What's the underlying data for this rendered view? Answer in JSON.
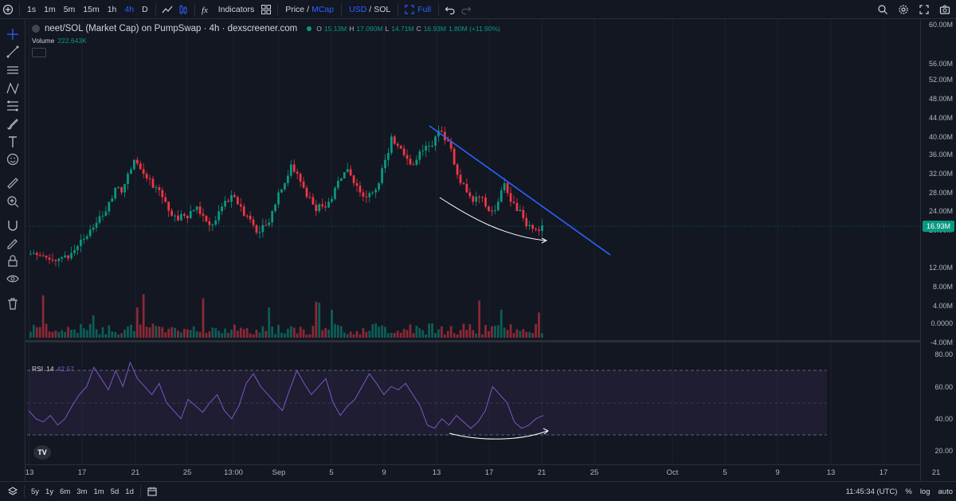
{
  "toolbar": {
    "intervals": [
      "1s",
      "1m",
      "5m",
      "15m",
      "1h",
      "4h",
      "D"
    ],
    "active_interval": "4h",
    "indicators_label": "Indicators",
    "price_label": "Price",
    "price_sep": "/",
    "mcap_label": "MCap",
    "usd_label": "USD",
    "sol_label": "SOL",
    "full_label": "Full"
  },
  "legend": {
    "symbol": "neet/SOL (Market Cap) on PumpSwap · 4h · dexscreener.com",
    "o_key": "O",
    "o_val": "15.13M",
    "h_key": "H",
    "h_val": "17.090M",
    "l_key": "L",
    "l_val": "14.71M",
    "c_key": "C",
    "c_val": "16.93M",
    "change": "1.80M (+11.90%)"
  },
  "volume": {
    "label": "Volume",
    "value": "222.643K"
  },
  "rsi": {
    "label": "RSI",
    "period": "14",
    "value": "42.57"
  },
  "yaxis_price": [
    "60.00M",
    "56.00M",
    "52.00M",
    "48.00M",
    "44.00M",
    "40.00M",
    "36.00M",
    "32.00M",
    "28.00M",
    "24.00M",
    "20.00M",
    "12.00M",
    "8.00M",
    "4.00M",
    "0.0000",
    "-4.00M"
  ],
  "yaxis_rsi": [
    "80.00",
    "60.00",
    "40.00",
    "20.00"
  ],
  "last_price": "16.93M",
  "xaxis": [
    "13",
    "17",
    "21",
    "25",
    "13:00",
    "Sep",
    "5",
    "9",
    "13",
    "17",
    "21",
    "25",
    "Oct",
    "5",
    "9",
    "13",
    "17",
    "21"
  ],
  "bottom": {
    "ranges": [
      "5y",
      "1y",
      "6m",
      "3m",
      "1m",
      "5d",
      "1d"
    ],
    "time": "11:45:34 (UTC)",
    "pct": "%",
    "log": "log",
    "auto": "auto"
  },
  "colors": {
    "up": "#089981",
    "down": "#f23645",
    "trend": "#2962ff",
    "rsi": "#7e57c2",
    "accent": "#2962ff"
  },
  "chart_data": {
    "type": "candlestick",
    "ylim": [
      -4000000,
      60000000
    ],
    "close_series_M": [
      11,
      10.5,
      10,
      9.5,
      9.8,
      10.5,
      11,
      12.5,
      14,
      16,
      17.5,
      19,
      22,
      25,
      24,
      28,
      31,
      29,
      27,
      25,
      24.5,
      22,
      19,
      18,
      19,
      20,
      21,
      19,
      17,
      18,
      21,
      22,
      23,
      21,
      19,
      17,
      15.5,
      17,
      20,
      24,
      26,
      30,
      28,
      25,
      23,
      20,
      21,
      22,
      25,
      27,
      29,
      26,
      24,
      23,
      24,
      26,
      31,
      36,
      34,
      32,
      30,
      31,
      33,
      34,
      36,
      37,
      35,
      30,
      26,
      24,
      22,
      23,
      21,
      20,
      22,
      26,
      22,
      20,
      18.5,
      17,
      16,
      16.9
    ],
    "rsi_series": [
      45,
      40,
      38,
      42,
      36,
      40,
      48,
      55,
      60,
      72,
      65,
      58,
      70,
      60,
      75,
      65,
      60,
      55,
      62,
      50,
      45,
      40,
      52,
      48,
      44,
      50,
      55,
      45,
      40,
      48,
      62,
      68,
      60,
      55,
      50,
      45,
      58,
      70,
      62,
      55,
      60,
      65,
      50,
      42,
      48,
      52,
      60,
      68,
      62,
      55,
      60,
      58,
      62,
      55,
      48,
      36,
      34,
      40,
      36,
      42,
      38,
      34,
      38,
      45,
      60,
      55,
      50,
      38,
      34,
      36,
      40,
      42
    ]
  }
}
